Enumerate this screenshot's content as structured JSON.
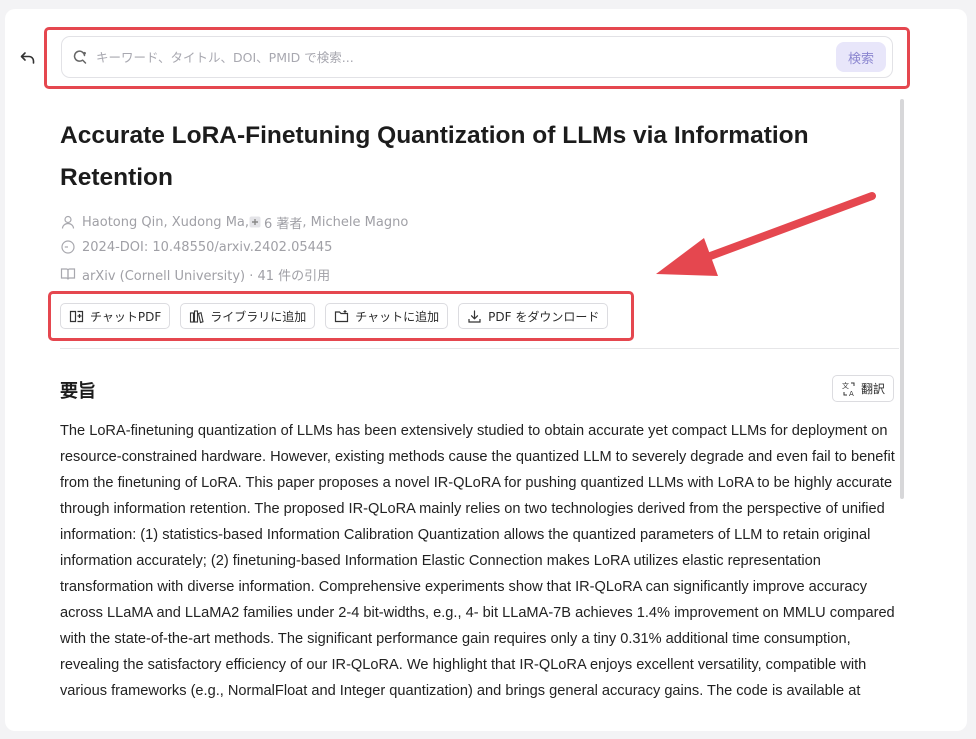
{
  "search": {
    "placeholder": "キーワード、タイトル、DOI、PMID で検索...",
    "button_label": "検索"
  },
  "paper": {
    "title": "Accurate LoRA-Finetuning Quantization of LLMs via Information Retention",
    "authors_text": "Haotong Qin, Xudong Ma, ",
    "authors_more": "6 著者",
    "authors_last": ", Michele Magno",
    "doi_text": "2024-DOI: 10.48550/arxiv.2402.05445",
    "venue_text": "arXiv (Cornell University) · 41 件の引用"
  },
  "actions": {
    "chat_pdf": "チャットPDF",
    "add_library": "ライブラリに追加",
    "add_chat": "チャットに追加",
    "download_pdf": "PDF をダウンロード"
  },
  "abstract_section": {
    "title": "要旨",
    "translate_label": "翻訳",
    "text": "The LoRA-finetuning quantization of LLMs has been extensively studied to obtain accurate yet compact LLMs for deployment on resource-constrained hardware. However, existing methods cause the quantized LLM to severely degrade and even fail to benefit from the finetuning of LoRA. This paper proposes a novel IR-QLoRA for pushing quantized LLMs with LoRA to be highly accurate through information retention. The proposed IR-QLoRA mainly relies on two technologies derived from the perspective of unified information: (1) statistics-based Information Calibration Quantization allows the quantized parameters of LLM to retain original information accurately; (2) finetuning-based Information Elastic Connection makes LoRA utilizes elastic representation transformation with diverse information. Comprehensive experiments show that IR-QLoRA can significantly improve accuracy across LLaMA and LLaMA2 families under 2-4 bit-widths, e.g., 4- bit LLaMA-7B achieves 1.4% improvement on MMLU compared with the state-of-the-art methods. The significant performance gain requires only a tiny 0.31% additional time consumption, revealing the satisfactory efficiency of our IR-QLoRA. We highlight that IR-QLoRA enjoys excellent versatility, compatible with various frameworks (e.g., NormalFloat and Integer quantization) and brings general accuracy gains. The code is available at"
  },
  "icons": {
    "back": "back-arrow-icon",
    "search": "search-icon",
    "author": "person-icon",
    "doi": "clock-icon",
    "venue": "book-icon",
    "chat_pdf": "chat-pdf-icon",
    "library": "library-icon",
    "folder": "folder-icon",
    "download": "download-icon",
    "translate": "translate-icon"
  },
  "colors": {
    "highlight_red": "#e5474f",
    "search_button_bg": "#e8e6fa",
    "search_button_text": "#8b86d0",
    "meta_text": "#a0a0a6"
  }
}
